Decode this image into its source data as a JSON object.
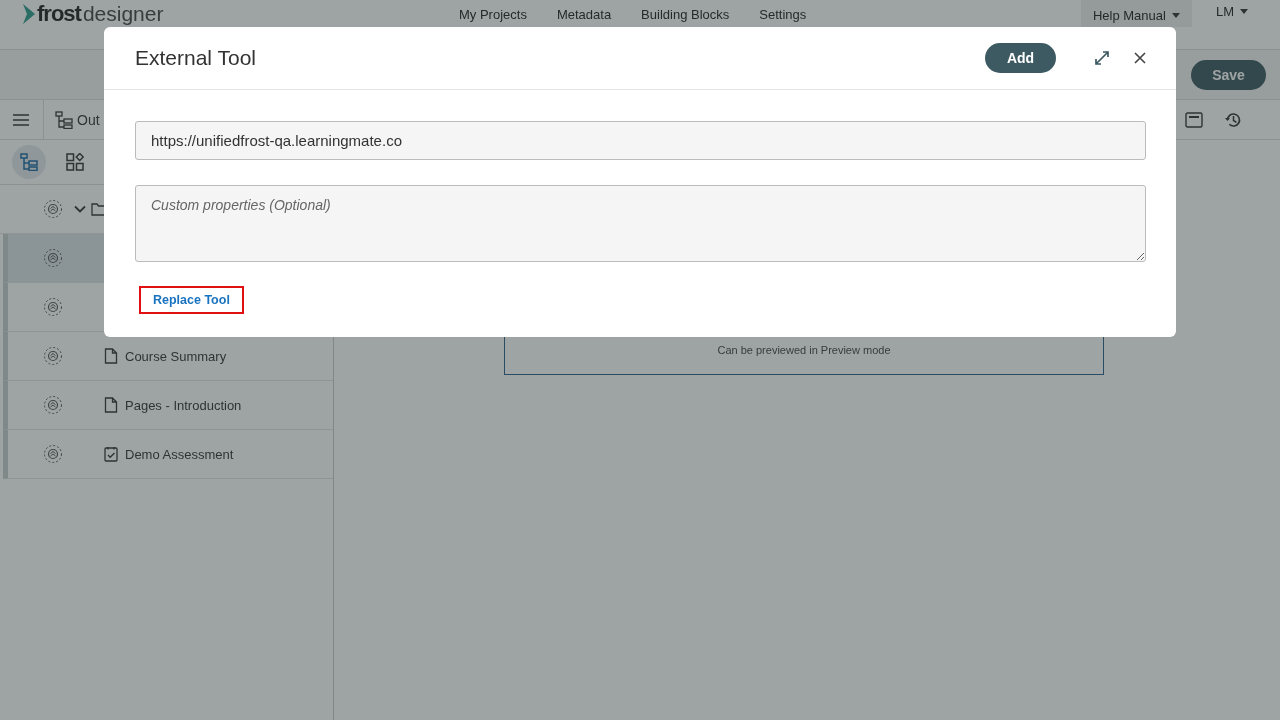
{
  "header": {
    "logo": {
      "part_1": "frost",
      "part_2": "designer"
    },
    "nav": [
      {
        "label": "My Projects"
      },
      {
        "label": "Metadata"
      },
      {
        "label": "Building Blocks"
      },
      {
        "label": "Settings"
      }
    ],
    "help": "Help Manual",
    "user": "LM"
  },
  "toolbar": {
    "save": "Save",
    "outline_label": "Out"
  },
  "sidebar": {
    "tabs": [
      {
        "selected": true
      },
      {
        "selected": false
      }
    ],
    "items": [
      {
        "kind": "folder",
        "expanded": true,
        "selected": false
      },
      {
        "selected": true
      },
      {
        "selected": false
      },
      {
        "kind": "page",
        "label": "Course Summary",
        "selected": false
      },
      {
        "kind": "page",
        "label": "Pages - Introduction",
        "selected": false
      },
      {
        "kind": "assessment",
        "label": "Demo Assessment",
        "selected": false
      }
    ]
  },
  "preview": {
    "text": "Can be previewed in Preview mode"
  },
  "modal": {
    "title": "External Tool",
    "add": "Add",
    "url": "https://unifiedfrost-qa.learningmate.co",
    "properties_placeholder": "Custom properties (Optional)",
    "replace": "Replace Tool"
  }
}
